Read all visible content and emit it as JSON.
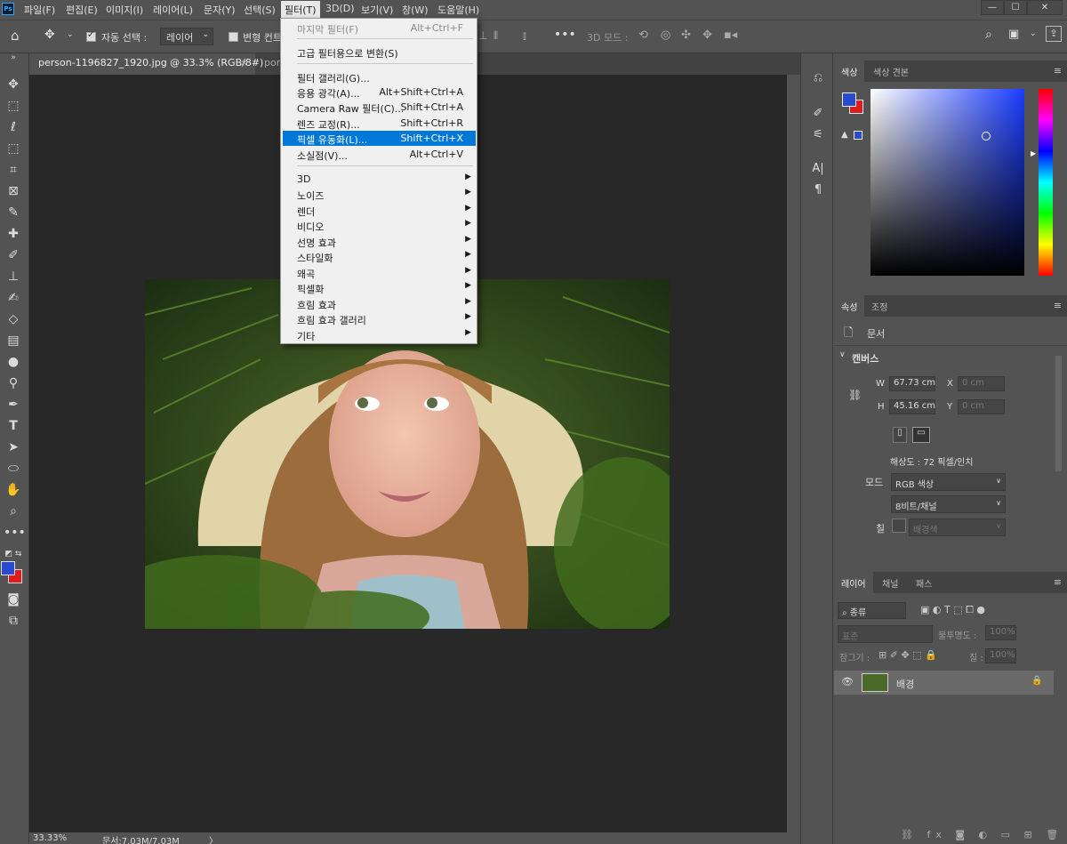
{
  "menubar": {
    "logo": "Ps",
    "items": [
      "파일(F)",
      "편집(E)",
      "이미지(I)",
      "레이어(L)",
      "문자(Y)",
      "선택(S)",
      "필터(T)",
      "3D(D)",
      "보기(V)",
      "창(W)",
      "도움말(H)"
    ],
    "window_controls": [
      "—",
      "☐",
      "✕"
    ]
  },
  "options": {
    "auto_select_label": "자동 선택 :",
    "auto_select_checked": true,
    "target_value": "레이어",
    "transform_label": "변형 컨트",
    "mode_3d_label": "3D 모드 :"
  },
  "tabs": [
    {
      "label": "person-1196827_1920.jpg @ 33.3% (RGB/8#)",
      "close": "×"
    },
    {
      "label": "port"
    }
  ],
  "filter_menu": {
    "items": [
      {
        "label": "마지막 필터(F)",
        "shortcut": "Alt+Ctrl+F",
        "disabled": true
      },
      {
        "label": "고급 필터용으로 변환(S)"
      },
      {
        "label": "필터 갤러리(G)..."
      },
      {
        "label": "응용 광각(A)...",
        "shortcut": "Alt+Shift+Ctrl+A"
      },
      {
        "label": "Camera Raw 필터(C)...",
        "shortcut": "Shift+Ctrl+A"
      },
      {
        "label": "렌즈 교정(R)...",
        "shortcut": "Shift+Ctrl+R"
      },
      {
        "label": "픽셀 유동화(L)...",
        "shortcut": "Shift+Ctrl+X",
        "highlighted": true
      },
      {
        "label": "소실점(V)...",
        "shortcut": "Alt+Ctrl+V"
      },
      {
        "label": "3D",
        "submenu": true
      },
      {
        "label": "노이즈",
        "submenu": true
      },
      {
        "label": "렌더",
        "submenu": true
      },
      {
        "label": "비디오",
        "submenu": true
      },
      {
        "label": "선명 효과",
        "submenu": true
      },
      {
        "label": "스타일화",
        "submenu": true
      },
      {
        "label": "왜곡",
        "submenu": true
      },
      {
        "label": "픽셀화",
        "submenu": true
      },
      {
        "label": "흐림 효과",
        "submenu": true
      },
      {
        "label": "흐림 효과 갤러리",
        "submenu": true
      },
      {
        "label": "기타",
        "submenu": true
      }
    ]
  },
  "color_panel": {
    "tabs": [
      "색상",
      "색상 견본"
    ],
    "foreground": "#2a4bd0",
    "background": "#e01b1b"
  },
  "properties_panel": {
    "tabs": [
      "속성",
      "조정"
    ],
    "doc_label": "문서",
    "section_title": "캔버스",
    "w_label": "W",
    "w_value": "67.73 cm",
    "h_label": "H",
    "h_value": "45.16 cm",
    "x_label": "X",
    "x_placeholder": "0 cm",
    "y_label": "Y",
    "y_placeholder": "0 cm",
    "resolution": "해상도 : 72 픽셀/인치",
    "mode_label": "모드",
    "mode_value": "RGB 색상",
    "bit_value": "8비트/채널",
    "fill_label": "칠",
    "fill_value": "배경색"
  },
  "layers_panel": {
    "tabs": [
      "레이어",
      "채널",
      "패스"
    ],
    "filter_kind": "종류",
    "blend_mode": "표준",
    "opacity_label": "불투명도 :",
    "opacity_value": "100%",
    "lock_label": "잠그기 :",
    "fill_label": "칠 :",
    "fill_value": "100%",
    "layer_name": "배경"
  },
  "status": {
    "zoom": "33.33%",
    "doc_size": "문서:7.03M/7.03M",
    "arrow": "〉"
  }
}
